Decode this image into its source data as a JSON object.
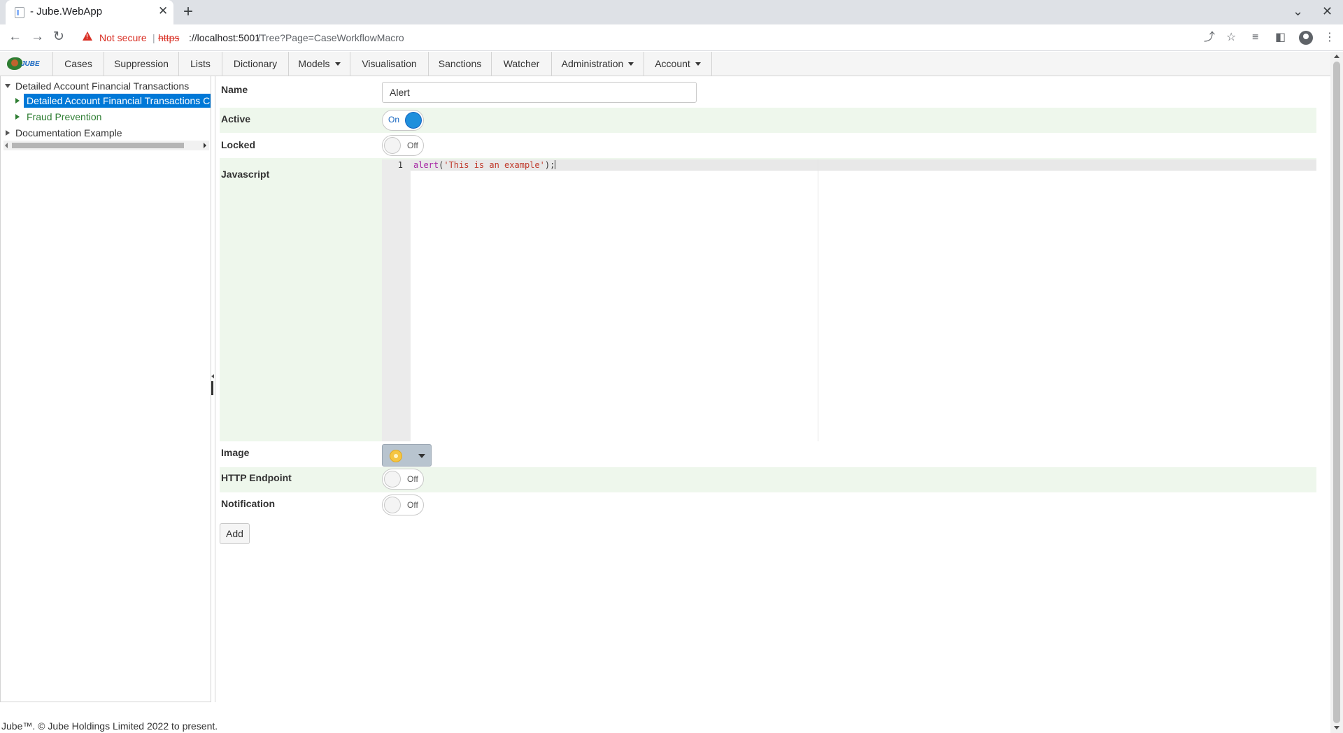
{
  "browser": {
    "tab_title": "- Jube.WebApp",
    "security_label": "Not secure",
    "url_scheme": "https",
    "url_host": "://localhost:5001",
    "url_path": "/Tree?Page=CaseWorkflowMacro"
  },
  "app": {
    "logo_text": "JUBE",
    "menu": [
      {
        "label": "Cases"
      },
      {
        "label": "Suppression"
      },
      {
        "label": "Lists"
      },
      {
        "label": "Dictionary"
      },
      {
        "label": "Models"
      },
      {
        "label": "Visualisation"
      },
      {
        "label": "Sanctions"
      },
      {
        "label": "Watcher"
      },
      {
        "label": "Administration"
      },
      {
        "label": "Account"
      }
    ]
  },
  "tree": {
    "items": [
      {
        "label": "Detailed Account Financial Transactions"
      },
      {
        "label": "Detailed Account Financial Transactions C"
      },
      {
        "label": "Fraud Prevention"
      },
      {
        "label": "Documentation Example"
      }
    ]
  },
  "form": {
    "name_label": "Name",
    "name_value": "Alert",
    "active_label": "Active",
    "active_state": "On",
    "locked_label": "Locked",
    "locked_state": "Off",
    "javascript_label": "Javascript",
    "code_line_number": "1",
    "code_fn": "alert",
    "code_open": "(",
    "code_str": "'This is an example'",
    "code_close": ");",
    "image_label": "Image",
    "image_icon": "sun-icon",
    "http_label": "HTTP Endpoint",
    "http_state": "Off",
    "notification_label": "Notification",
    "notification_state": "Off",
    "add_button": "Add"
  },
  "footer": {
    "text": "Jube™. © Jube Holdings Limited 2022 to present."
  },
  "colors": {
    "accent": "#1f8fdc",
    "row_highlight": "#eef7ec",
    "tree_selected": "#0078d7",
    "tree_child": "#2e7d32"
  }
}
